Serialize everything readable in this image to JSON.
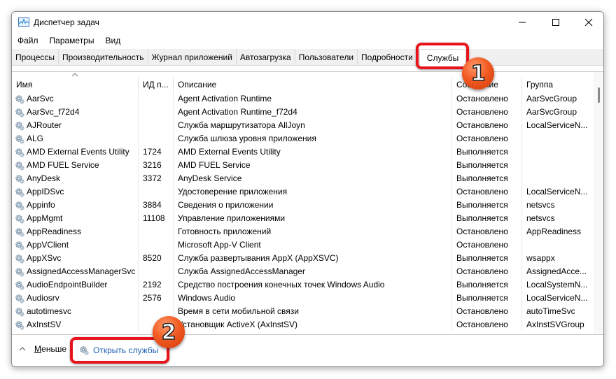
{
  "window": {
    "title": "Диспетчер задач",
    "icon": "task-manager-icon",
    "controls": {
      "minimize": "minimize-icon",
      "maximize": "maximize-icon",
      "close": "close-icon"
    }
  },
  "menu": [
    "Файл",
    "Параметры",
    "Вид"
  ],
  "tabs": [
    {
      "label": "Процессы",
      "active": false
    },
    {
      "label": "Производительность",
      "active": false
    },
    {
      "label": "Журнал приложений",
      "active": false
    },
    {
      "label": "Автозагрузка",
      "active": false
    },
    {
      "label": "Пользователи",
      "active": false
    },
    {
      "label": "Подробности",
      "active": false
    },
    {
      "label": "Службы",
      "active": true
    }
  ],
  "columns": {
    "name": "Имя",
    "pid": "ИД п...",
    "description": "Описание",
    "state": "Состояние",
    "group": "Группа"
  },
  "sort": {
    "column": "name",
    "direction": "ascending"
  },
  "rows": [
    {
      "name": "AarSvc",
      "pid": "",
      "description": "Agent Activation Runtime",
      "state": "Остановлено",
      "group": "AarSvcGroup"
    },
    {
      "name": "AarSvc_f72d4",
      "pid": "",
      "description": "Agent Activation Runtime_f72d4",
      "state": "Остановлено",
      "group": "AarSvcGroup"
    },
    {
      "name": "AJRouter",
      "pid": "",
      "description": "Служба маршрутизатора AllJoyn",
      "state": "Остановлено",
      "group": "LocalServiceN..."
    },
    {
      "name": "ALG",
      "pid": "",
      "description": "Служба шлюза уровня приложения",
      "state": "Остановлено",
      "group": ""
    },
    {
      "name": "AMD External Events Utility",
      "pid": "1724",
      "description": "AMD External Events Utility",
      "state": "Выполняется",
      "group": ""
    },
    {
      "name": "AMD FUEL Service",
      "pid": "3216",
      "description": "AMD FUEL Service",
      "state": "Выполняется",
      "group": ""
    },
    {
      "name": "AnyDesk",
      "pid": "3372",
      "description": "AnyDesk Service",
      "state": "Выполняется",
      "group": ""
    },
    {
      "name": "AppIDSvc",
      "pid": "",
      "description": "Удостоверение приложения",
      "state": "Остановлено",
      "group": "LocalServiceN..."
    },
    {
      "name": "Appinfo",
      "pid": "3884",
      "description": "Сведения о приложении",
      "state": "Выполняется",
      "group": "netsvcs"
    },
    {
      "name": "AppMgmt",
      "pid": "11108",
      "description": "Управление приложениями",
      "state": "Выполняется",
      "group": "netsvcs"
    },
    {
      "name": "AppReadiness",
      "pid": "",
      "description": "Готовность приложений",
      "state": "Остановлено",
      "group": "AppReadiness"
    },
    {
      "name": "AppVClient",
      "pid": "",
      "description": "Microsoft App-V Client",
      "state": "Остановлено",
      "group": ""
    },
    {
      "name": "AppXSvc",
      "pid": "8520",
      "description": "Служба развертывания AppX (AppXSVC)",
      "state": "Выполняется",
      "group": "wsappx"
    },
    {
      "name": "AssignedAccessManagerSvc",
      "pid": "",
      "description": "Служба AssignedAccessManager",
      "state": "Остановлено",
      "group": "AssignedAcce..."
    },
    {
      "name": "AudioEndpointBuilder",
      "pid": "2192",
      "description": "Средство построения конечных точек Windows Audio",
      "state": "Выполняется",
      "group": "LocalSystemN..."
    },
    {
      "name": "Audiosrv",
      "pid": "2576",
      "description": "Windows Audio",
      "state": "Выполняется",
      "group": "LocalServiceN..."
    },
    {
      "name": "autotimesvc",
      "pid": "",
      "description": "Время в сети мобильной связи",
      "state": "Остановлено",
      "group": "autoTimeSvc"
    },
    {
      "name": "AxInstSV",
      "pid": "",
      "description": "Установщик ActiveX (AxInstSV)",
      "state": "Остановлено",
      "group": "AxInstSVGroup"
    }
  ],
  "footer": {
    "less_label_underlined": "М",
    "less_label_rest": "еньше",
    "open_services_label": "Открыть службы"
  },
  "annotations": {
    "badge_1": "1",
    "badge_2": "2",
    "highlight_color": "#e8141c",
    "badge_color": "#f25a22"
  },
  "colors": {
    "link": "#1a5fb4",
    "tabbar_bg": "#f0f0f0"
  }
}
